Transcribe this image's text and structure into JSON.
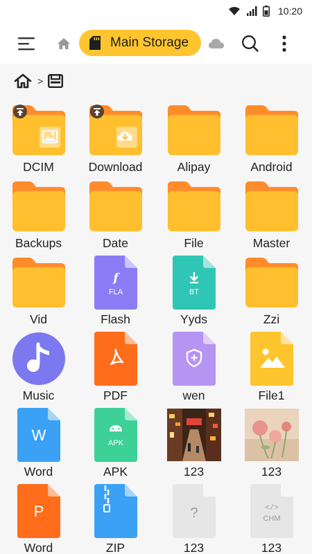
{
  "status": {
    "time": "10:20"
  },
  "toolbar": {
    "storage_label": "Main Storage"
  },
  "items": [
    {
      "name": "DCIM",
      "kind": "folder",
      "badge": "upload",
      "overlay": "image"
    },
    {
      "name": "Download",
      "kind": "folder",
      "badge": "upload",
      "overlay": "download"
    },
    {
      "name": "Alipay",
      "kind": "folder"
    },
    {
      "name": "Android",
      "kind": "folder"
    },
    {
      "name": "Backups",
      "kind": "folder"
    },
    {
      "name": "Date",
      "kind": "folder"
    },
    {
      "name": "File",
      "kind": "folder"
    },
    {
      "name": "Master",
      "kind": "folder"
    },
    {
      "name": "Vid",
      "kind": "folder"
    },
    {
      "name": "Flash",
      "kind": "doc",
      "color": "#8b7cf6",
      "glyph": "FLA",
      "icon": "flash-icon"
    },
    {
      "name": "Yyds",
      "kind": "doc",
      "color": "#2fc6b5",
      "glyph": "BT",
      "icon": "torrent-icon"
    },
    {
      "name": "Zzi",
      "kind": "folder"
    },
    {
      "name": "Music",
      "kind": "music",
      "color": "#7b78f0"
    },
    {
      "name": "PDF",
      "kind": "doc",
      "color": "#ff6d1a",
      "icon": "pdf-icon"
    },
    {
      "name": "wen",
      "kind": "doc",
      "color": "#b694f2",
      "icon": "shield-icon"
    },
    {
      "name": "File1",
      "kind": "doc",
      "color": "#ffc52e",
      "icon": "image-icon"
    },
    {
      "name": "Word",
      "kind": "doc",
      "color": "#3aa1f5",
      "glyph": "W",
      "icon": "word-icon"
    },
    {
      "name": "APK",
      "kind": "doc",
      "color": "#3dd197",
      "glyph": "APK",
      "icon": "android-icon"
    },
    {
      "name": "123",
      "kind": "photo",
      "scene": "street"
    },
    {
      "name": "123",
      "kind": "photo",
      "scene": "flowers"
    },
    {
      "name": "Word",
      "kind": "doc",
      "color": "#ff6d1a",
      "glyph": "P",
      "icon": "powerpoint-icon"
    },
    {
      "name": "ZIP",
      "kind": "doc",
      "color": "#3aa1f5",
      "icon": "zipper-icon"
    },
    {
      "name": "123",
      "kind": "doc",
      "color": "#e6e6e6",
      "glyph": "?",
      "icon": "unknown-file-icon",
      "light": true
    },
    {
      "name": "123",
      "kind": "doc",
      "color": "#e6e6e6",
      "glyph": "CHM",
      "icon": "chm-icon",
      "light": true
    }
  ]
}
